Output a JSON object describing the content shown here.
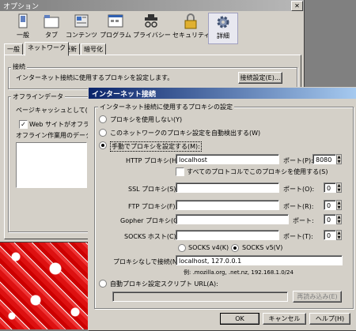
{
  "options_window": {
    "title": "オプション",
    "toolbar": [
      {
        "label": "一般",
        "icon": "general-icon"
      },
      {
        "label": "タブ",
        "icon": "tabs-icon"
      },
      {
        "label": "コンテンツ",
        "icon": "content-icon"
      },
      {
        "label": "プログラム",
        "icon": "programs-icon"
      },
      {
        "label": "プライバシー",
        "icon": "privacy-icon"
      },
      {
        "label": "セキュリティ",
        "icon": "security-icon"
      },
      {
        "label": "詳細",
        "icon": "advanced-icon"
      }
    ],
    "tabs": [
      "一般",
      "ネットワーク",
      "更新",
      "暗号化"
    ],
    "connection_group": "接続",
    "connection_text": "インターネット接続に使用するプロキシを設定します。",
    "connection_button": "接続設定(E)...",
    "offline_group": "オフラインデータ",
    "cache_text": "ページキャッシュとして(L)",
    "website_offline_checkbox": "Web サイトがオフライン",
    "offline_apps_text": "オフライン作業用のデータを"
  },
  "dialog": {
    "title": "インターネット接続",
    "group_label": "インターネット接続に使用するプロキシの設定",
    "radio_none": "プロキシを使用しない(Y)",
    "radio_auto_detect": "このネットワークのプロキシ設定を自動検出する(W)",
    "radio_manual": "手動でプロキシを設定する(M):",
    "http_label": "HTTP プロキシ(H):",
    "http_value": "localhost",
    "http_port_label": "ポート(P):",
    "http_port": "8080",
    "same_proxy_checkbox": "すべてのプロトコルでこのプロキシを使用する(S)",
    "ssl_label": "SSL プロキシ(S):",
    "ssl_value": "",
    "ssl_port_label": "ポート(O):",
    "ssl_port": "0",
    "ftp_label": "FTP プロキシ(F):",
    "ftp_value": "",
    "ftp_port_label": "ポート(R):",
    "ftp_port": "0",
    "gopher_label": "Gopher プロキシ(G):",
    "gopher_value": "",
    "gopher_port_label": "ポート:",
    "gopher_port": "0",
    "socks_label": "SOCKS ホスト(C):",
    "socks_value": "",
    "socks_port_label": "ポート(T):",
    "socks_port": "0",
    "socks_v4": "SOCKS v4(K)",
    "socks_v5": "SOCKS v5(V)",
    "no_proxy_label": "プロキシなしで接続(N):",
    "no_proxy_value": "localhost, 127.0.0.1",
    "example_text": "例: .mozilla.org, .net.nz, 192.168.1.0/24",
    "radio_pac": "自動プロキシ設定スクリプト URL(A):",
    "pac_value": "",
    "reload_button": "再読み込み(E)",
    "ok_button": "OK",
    "cancel_button": "キャンセル",
    "help_button": "ヘルプ(H)"
  }
}
